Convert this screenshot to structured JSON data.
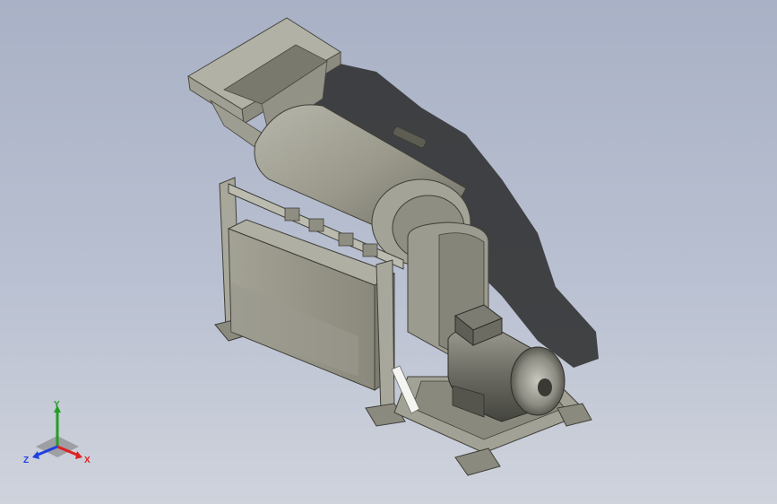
{
  "viewport": {
    "description_icon": "3d-model-viewport"
  },
  "triad": {
    "x_label": "X",
    "y_label": "Y",
    "z_label": "Z",
    "colors": {
      "x": "#e02020",
      "y": "#20a020",
      "z": "#2040e0"
    }
  },
  "colors": {
    "background_top": "#a9b1c6",
    "background_bottom": "#cfd3dc",
    "metal_light": "#a6a598",
    "metal_mid": "#8d8c7f",
    "metal_dark": "#5f5e54",
    "shadow": "#2a2a2a"
  }
}
